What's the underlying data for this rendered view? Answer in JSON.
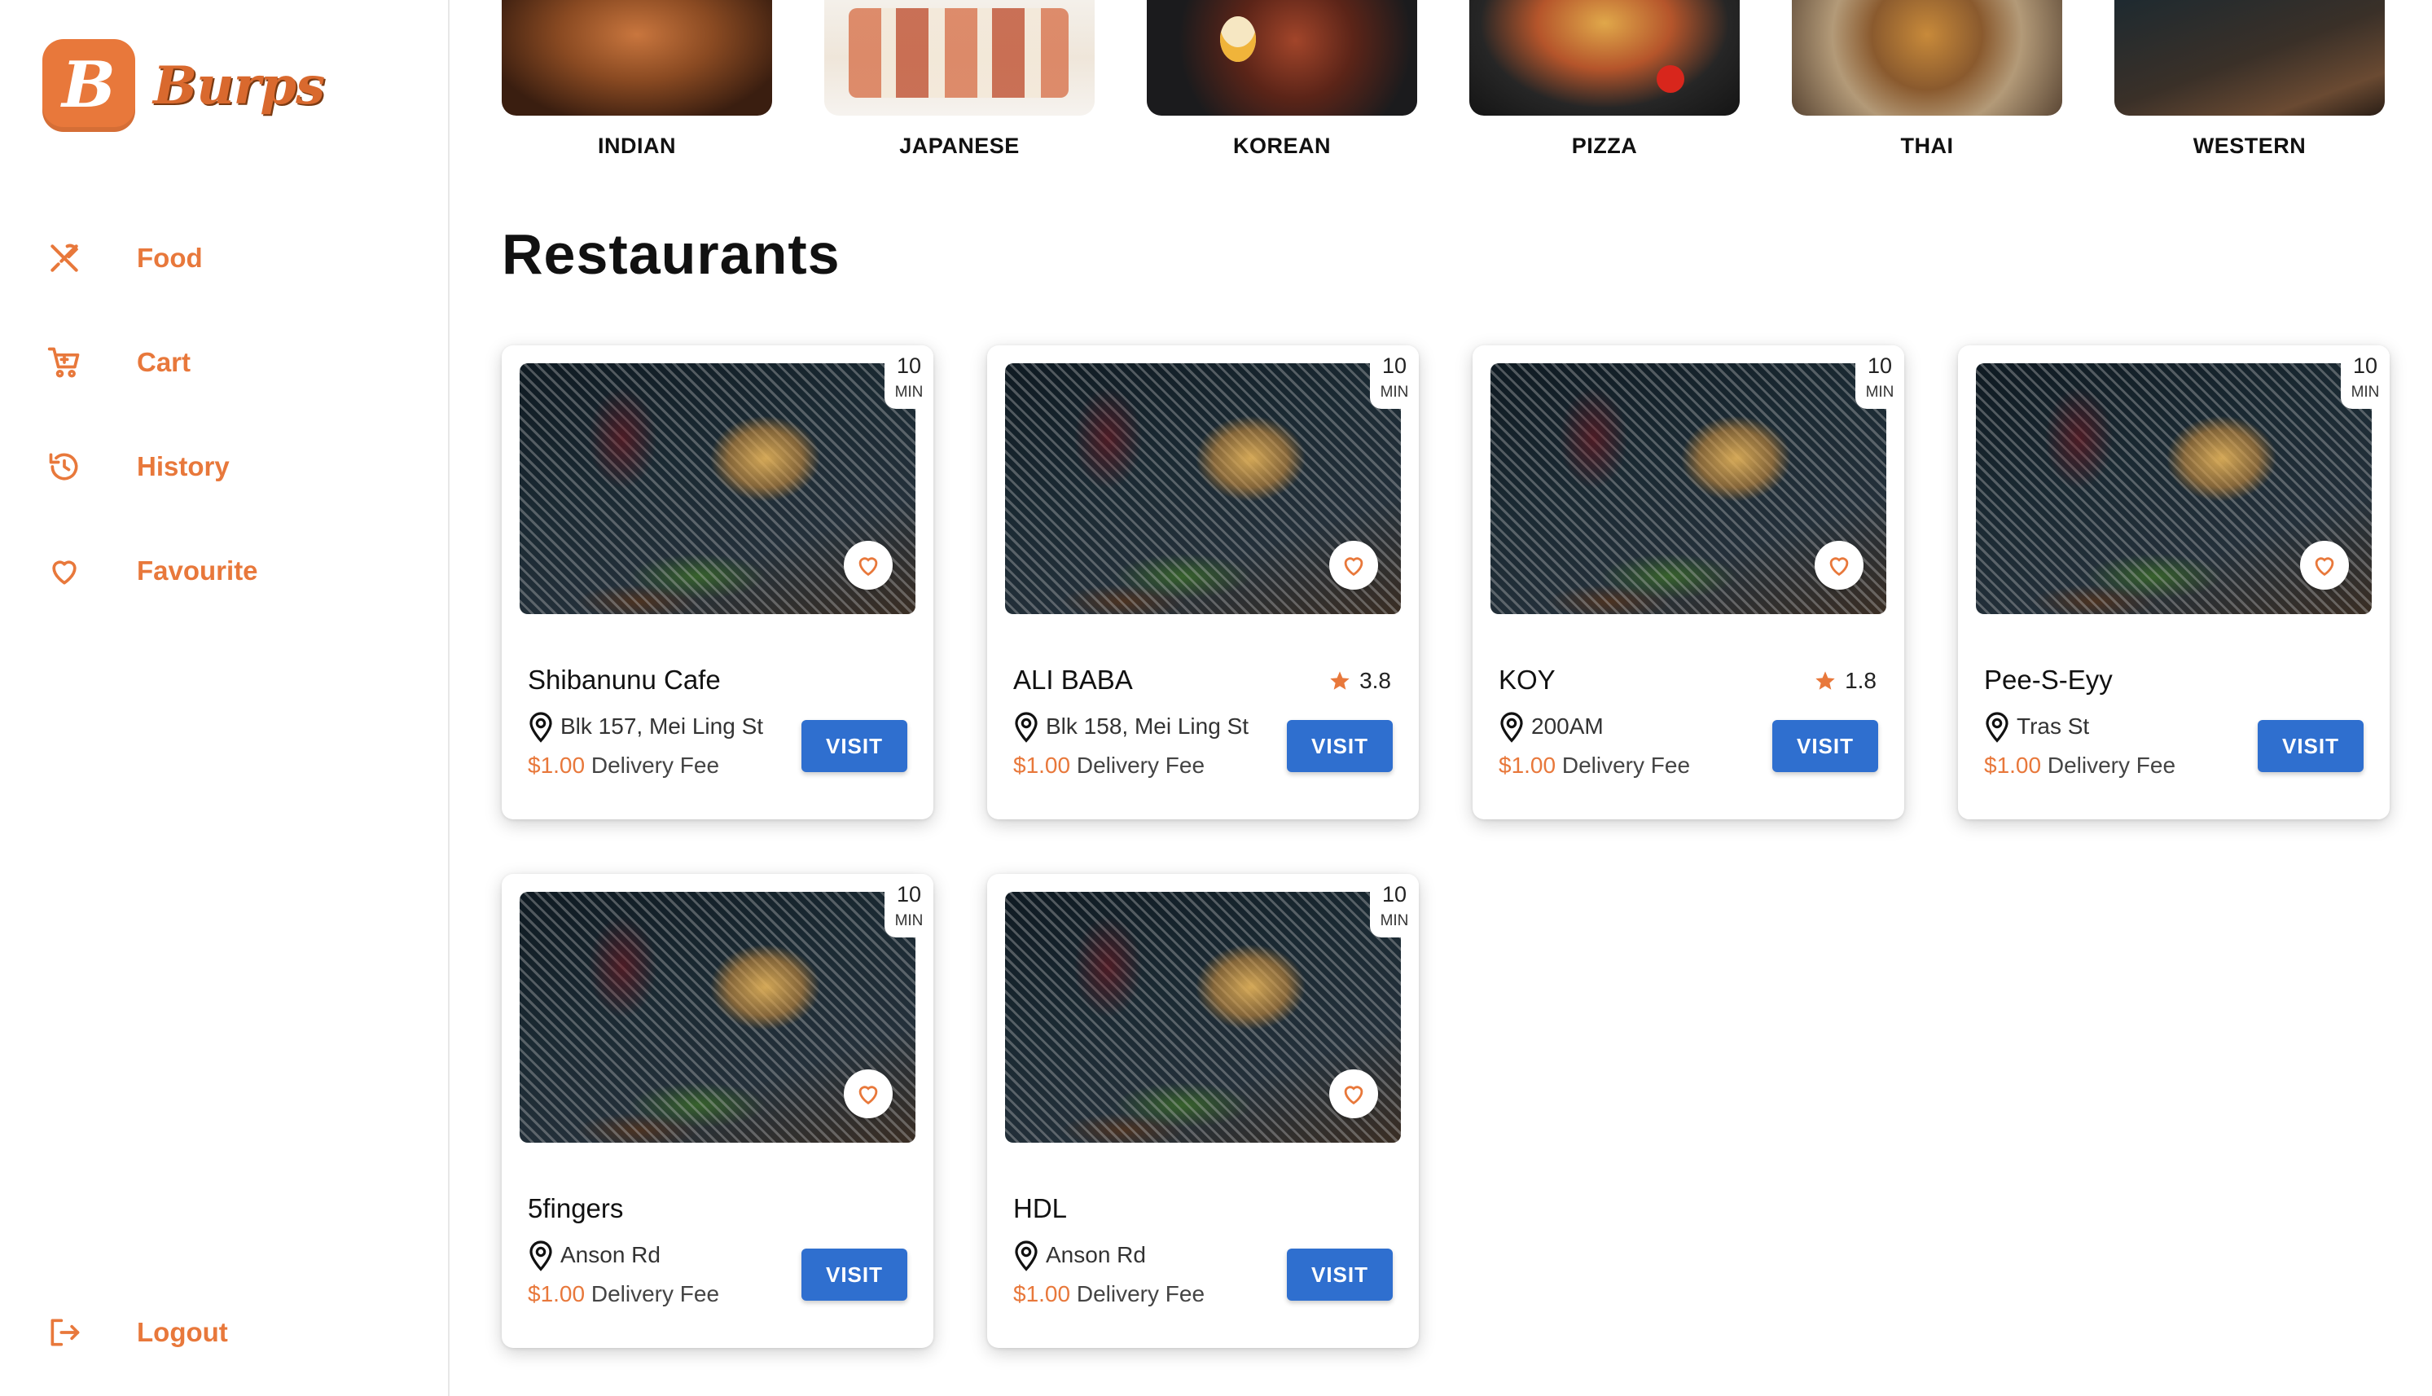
{
  "brand": {
    "badge_letter": "B",
    "name": "Burps"
  },
  "sidebar": {
    "items": [
      {
        "label": "Food",
        "icon": "fork-knife-icon"
      },
      {
        "label": "Cart",
        "icon": "cart-icon"
      },
      {
        "label": "History",
        "icon": "history-icon"
      },
      {
        "label": "Favourite",
        "icon": "heart-icon"
      }
    ],
    "logout": {
      "label": "Logout",
      "icon": "logout-icon"
    }
  },
  "categories": [
    {
      "label": "INDIAN"
    },
    {
      "label": "JAPANESE"
    },
    {
      "label": "KOREAN"
    },
    {
      "label": "PIZZA"
    },
    {
      "label": "THAI"
    },
    {
      "label": "WESTERN"
    }
  ],
  "section_title": "Restaurants",
  "restaurants": [
    {
      "name": "Shibanunu Cafe",
      "rating": "",
      "address": "Blk 157, Mei Ling St",
      "fee_price": "$1.00",
      "fee_label": " Delivery Fee",
      "eta_num": "10",
      "eta_unit": "MIN",
      "visit_label": "VISIT"
    },
    {
      "name": "ALI BABA",
      "rating": "3.8",
      "address": "Blk 158, Mei Ling St",
      "fee_price": "$1.00",
      "fee_label": " Delivery Fee",
      "eta_num": "10",
      "eta_unit": "MIN",
      "visit_label": "VISIT"
    },
    {
      "name": "KOY",
      "rating": "1.8",
      "address": "200AM",
      "fee_price": "$1.00",
      "fee_label": " Delivery Fee",
      "eta_num": "10",
      "eta_unit": "MIN",
      "visit_label": "VISIT"
    },
    {
      "name": "Pee-S-Eyy",
      "rating": "",
      "address": "Tras St",
      "fee_price": "$1.00",
      "fee_label": " Delivery Fee",
      "eta_num": "10",
      "eta_unit": "MIN",
      "visit_label": "VISIT"
    },
    {
      "name": "5fingers",
      "rating": "",
      "address": "Anson Rd",
      "fee_price": "$1.00",
      "fee_label": " Delivery Fee",
      "eta_num": "10",
      "eta_unit": "MIN",
      "visit_label": "VISIT"
    },
    {
      "name": "HDL",
      "rating": "",
      "address": "Anson Rd",
      "fee_price": "$1.00",
      "fee_label": " Delivery Fee",
      "eta_num": "10",
      "eta_unit": "MIN",
      "visit_label": "VISIT"
    }
  ],
  "colors": {
    "accent": "#e8783b",
    "button": "#2f6fcf",
    "star": "#e8783b"
  }
}
